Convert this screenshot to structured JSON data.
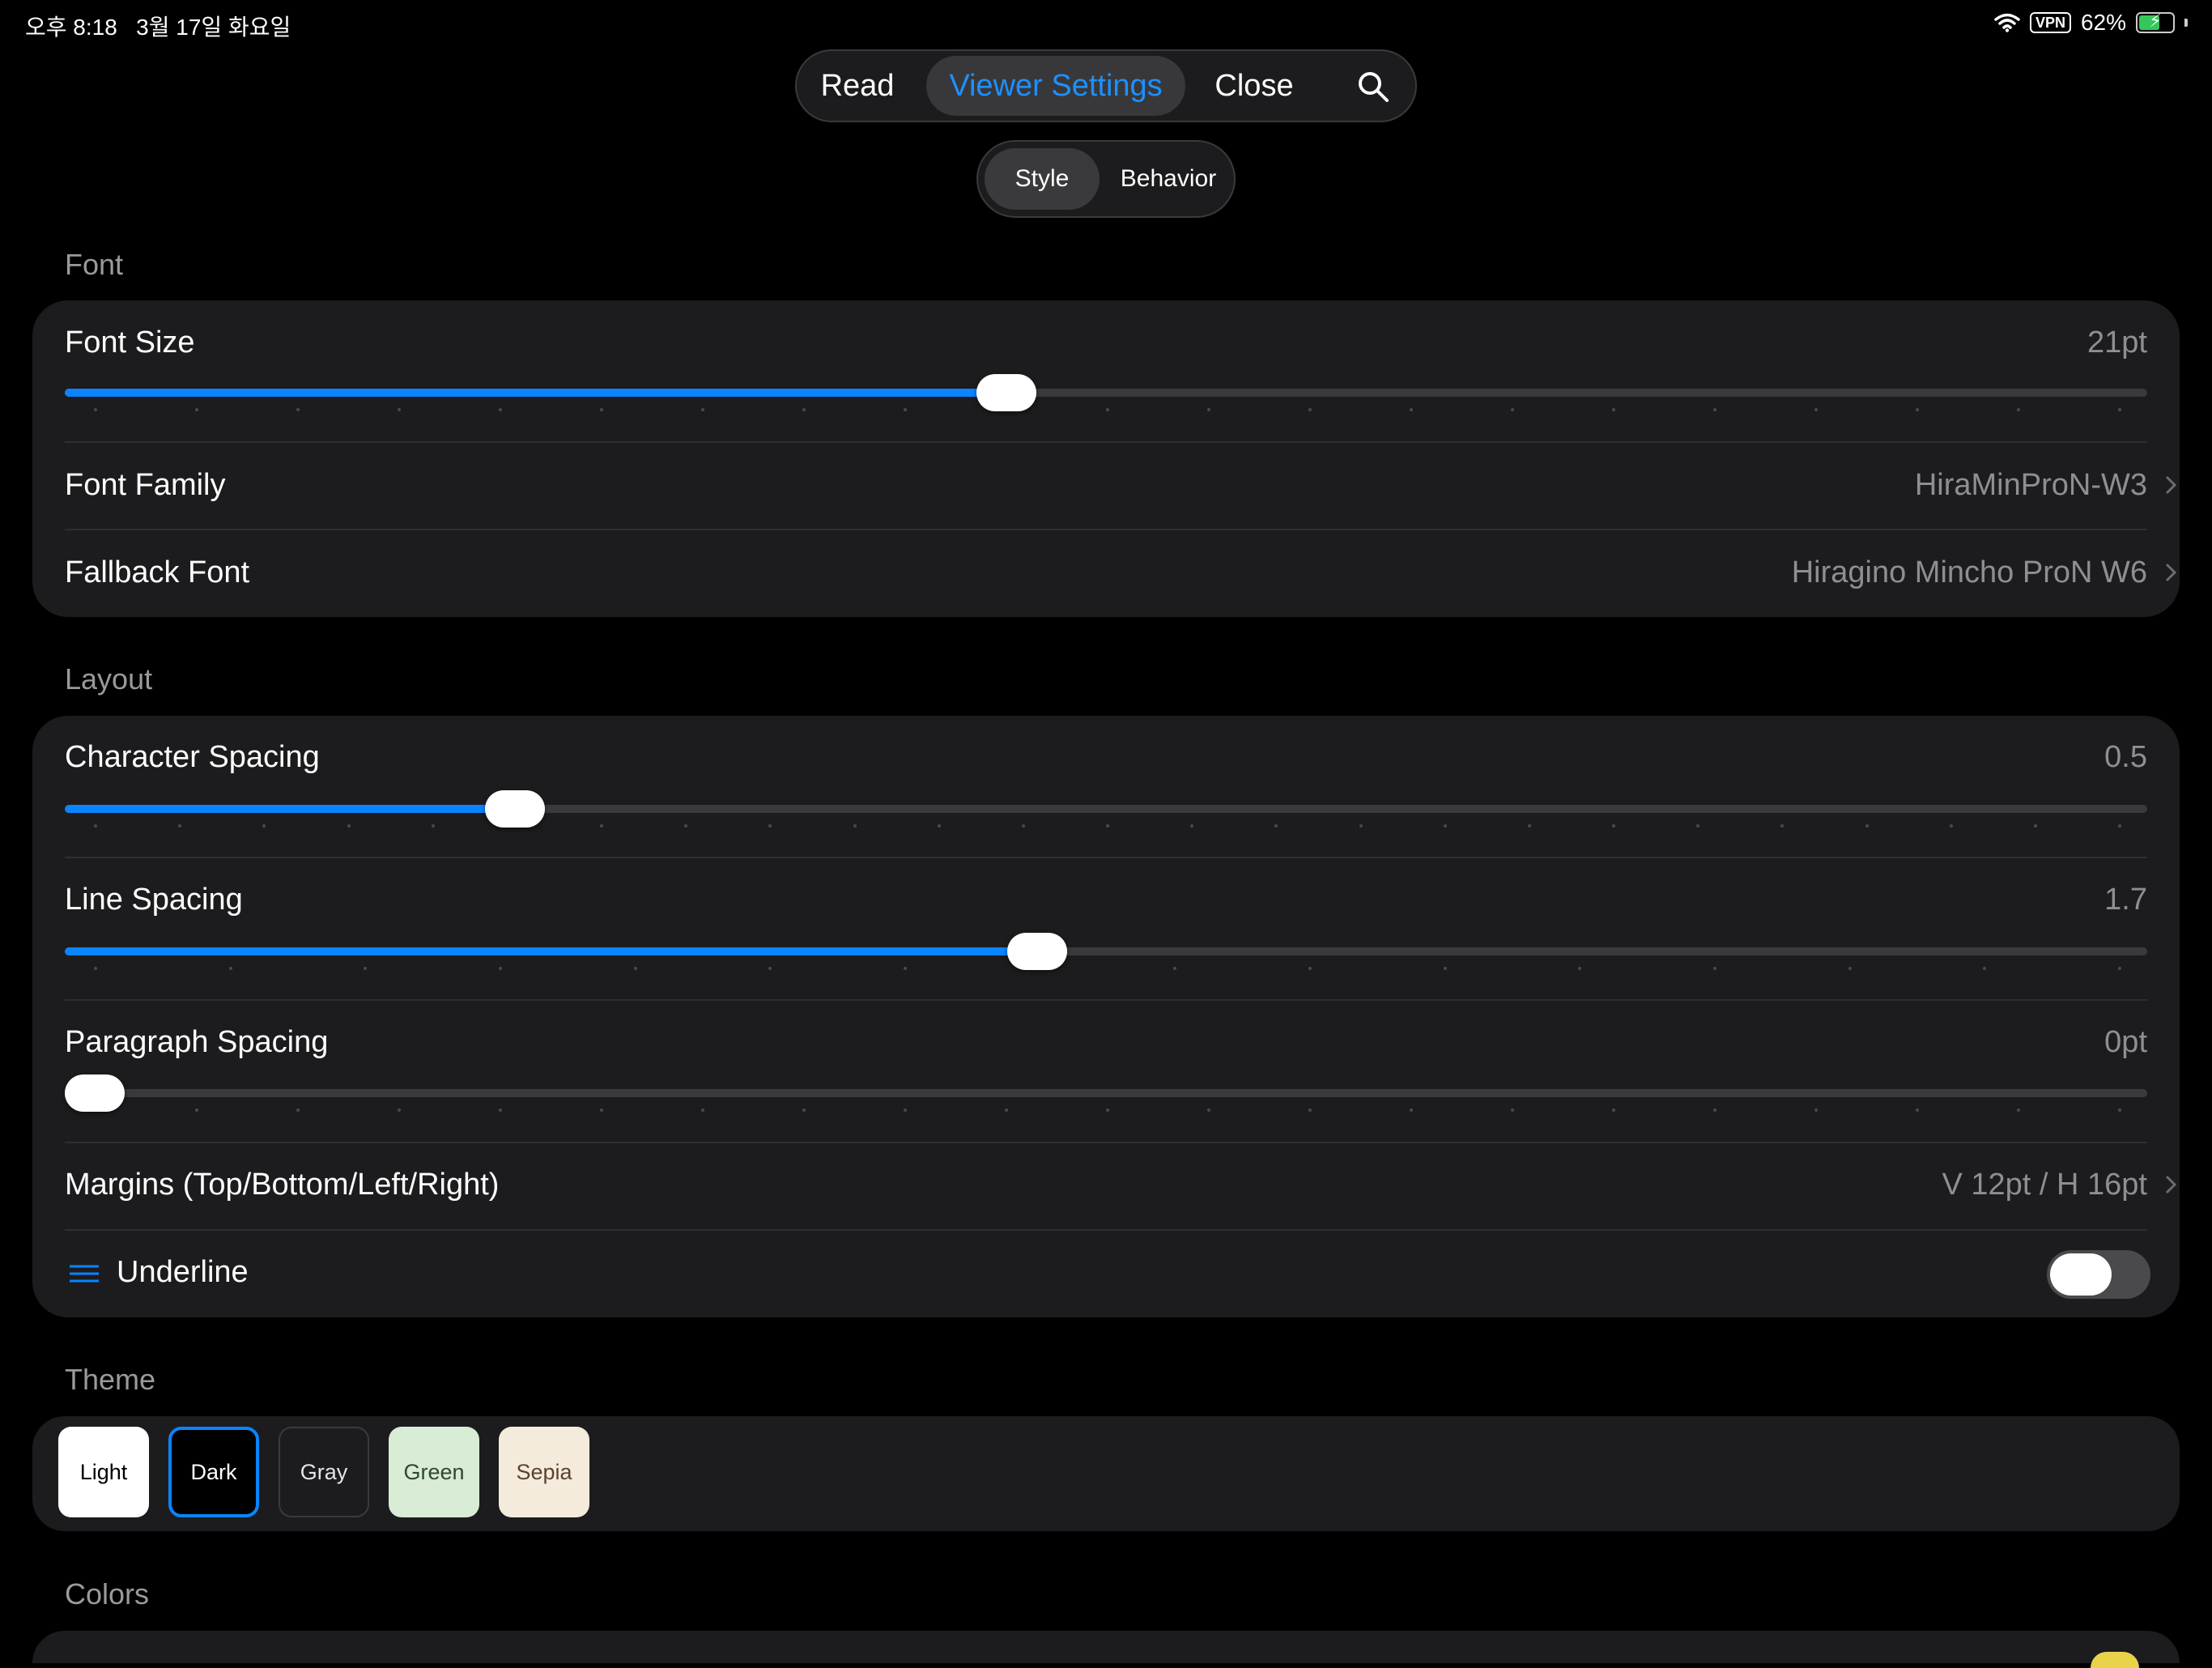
{
  "status": {
    "time": "오후 8:18",
    "date": "3월 17일 화요일",
    "vpn": "VPN",
    "battery": "62%",
    "battery_level": 0.62
  },
  "nav": {
    "read": "Read",
    "viewer_settings": "Viewer Settings",
    "close": "Close"
  },
  "subnav": {
    "style": "Style",
    "behavior": "Behavior"
  },
  "font": {
    "section": "Font",
    "size": {
      "label": "Font Size",
      "value": "21pt",
      "fraction": 0.452,
      "ticks": 21
    },
    "family": {
      "label": "Font Family",
      "value": "HiraMinProN-W3"
    },
    "fallback": {
      "label": "Fallback Font",
      "value": "Hiragino Mincho ProN W6"
    }
  },
  "layout": {
    "section": "Layout",
    "char_spacing": {
      "label": "Character Spacing",
      "value": "0.5",
      "fraction": 0.216,
      "ticks": 25
    },
    "line_spacing": {
      "label": "Line Spacing",
      "value": "1.7",
      "fraction": 0.467,
      "ticks": 16
    },
    "paragraph_spacing": {
      "label": "Paragraph Spacing",
      "value": "0pt",
      "fraction": 0.0,
      "ticks": 21
    },
    "margins": {
      "label": "Margins (Top/Bottom/Left/Right)",
      "value": "V 12pt / H 16pt"
    },
    "underline": {
      "label": "Underline",
      "on": false
    }
  },
  "theme": {
    "section": "Theme",
    "options": [
      {
        "label": "Light",
        "bg": "#ffffff",
        "fg": "#000000",
        "selected": false
      },
      {
        "label": "Dark",
        "bg": "#000000",
        "fg": "#ffffff",
        "selected": true
      },
      {
        "label": "Gray",
        "bg": "#1c1c1e",
        "fg": "#e5e5e5",
        "selected": false
      },
      {
        "label": "Green",
        "bg": "#d9ecd6",
        "fg": "#2d4a2b",
        "selected": false
      },
      {
        "label": "Sepia",
        "bg": "#f4ebdc",
        "fg": "#5b4330",
        "selected": false
      }
    ]
  },
  "colors": {
    "section": "Colors",
    "accent": "#0a84ff"
  }
}
